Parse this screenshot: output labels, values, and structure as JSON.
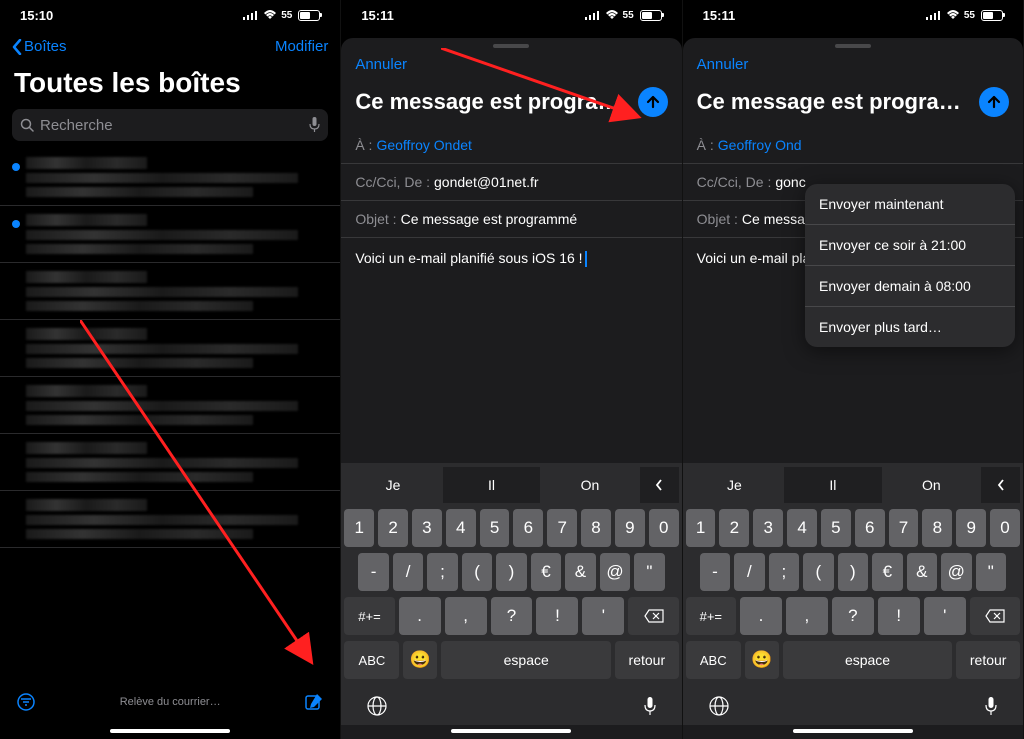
{
  "status": {
    "time1": "15:10",
    "time2": "15:11",
    "time3": "15:11",
    "battery": "55"
  },
  "screen1": {
    "back": "Boîtes",
    "edit": "Modifier",
    "title": "Toutes les boîtes",
    "search_placeholder": "Recherche",
    "footer_status": "Relève du courrier…"
  },
  "compose": {
    "cancel": "Annuler",
    "subject_title": "Ce message est programmé",
    "to_label": "À :",
    "to_value": "Geoffroy Ondet",
    "to_value_truncated": "Geoffroy Ond",
    "cc_label": "Cc/Cci, De :",
    "cc_value": "gondet@01net.fr",
    "cc_value_truncated": "gonc",
    "subject_label": "Objet :",
    "subject_value": "Ce message est programmé",
    "subject_value_truncated": "Ce messa",
    "body": "Voici un e-mail planifié sous iOS 16 !"
  },
  "keyboard": {
    "suggestions": [
      "Je",
      "Il",
      "On"
    ],
    "row1": [
      "1",
      "2",
      "3",
      "4",
      "5",
      "6",
      "7",
      "8",
      "9",
      "0"
    ],
    "row2": [
      "-",
      "/",
      ";",
      "(",
      ")",
      "€",
      "&",
      "@",
      "\""
    ],
    "row3_alt": "#+=",
    "row3": [
      ".",
      ",",
      "?",
      "!",
      "'"
    ],
    "abc": "ABC",
    "space": "espace",
    "return": "retour"
  },
  "menu": {
    "items": [
      "Envoyer maintenant",
      "Envoyer ce soir à 21:00",
      "Envoyer demain à 08:00",
      "Envoyer plus tard…"
    ]
  }
}
